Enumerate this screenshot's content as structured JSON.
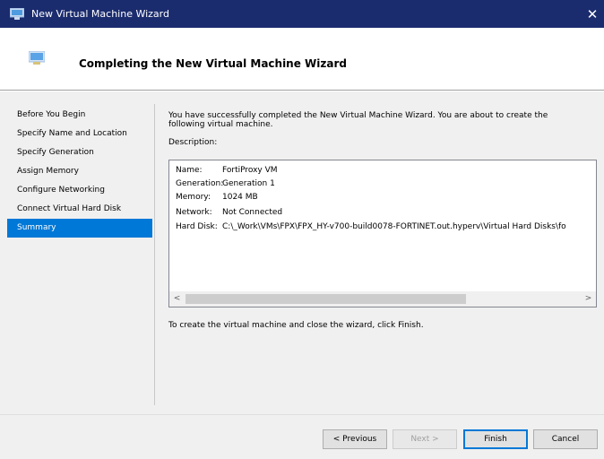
{
  "window": {
    "title": "New Virtual Machine Wizard",
    "close_glyph": "✕"
  },
  "header": {
    "title": "Completing the New Virtual Machine Wizard"
  },
  "nav": {
    "items": [
      {
        "label": "Before You Begin",
        "selected": false
      },
      {
        "label": "Specify Name and Location",
        "selected": false
      },
      {
        "label": "Specify Generation",
        "selected": false
      },
      {
        "label": "Assign Memory",
        "selected": false
      },
      {
        "label": "Configure Networking",
        "selected": false
      },
      {
        "label": "Connect Virtual Hard Disk",
        "selected": false
      },
      {
        "label": "Summary",
        "selected": true
      }
    ]
  },
  "content": {
    "intro": "You have successfully completed the New Virtual Machine Wizard. You are about to create the following virtual machine.",
    "description_label": "Description:",
    "summary": [
      {
        "label": "Name:",
        "value": "FortiProxy VM"
      },
      {
        "label": "Generation:",
        "value": "Generation 1"
      },
      {
        "label": "Memory:",
        "value": "1024 MB"
      },
      {
        "label": "Network:",
        "value": "Not Connected"
      },
      {
        "label": "Hard Disk:",
        "value": "C:\\_Work\\VMs\\FPX\\FPX_HY-v700-build0078-FORTINET.out.hyperv\\Virtual Hard Disks\\fo"
      }
    ],
    "finish_note": "To create the virtual machine and close the wizard, click Finish."
  },
  "scrollbar": {
    "left_arrow": "<",
    "right_arrow": ">"
  },
  "buttons": {
    "previous": "< Previous",
    "next": "Next >",
    "finish": "Finish",
    "cancel": "Cancel"
  },
  "colors": {
    "titlebar": "#1b2c6e",
    "selection": "#0078d7"
  }
}
